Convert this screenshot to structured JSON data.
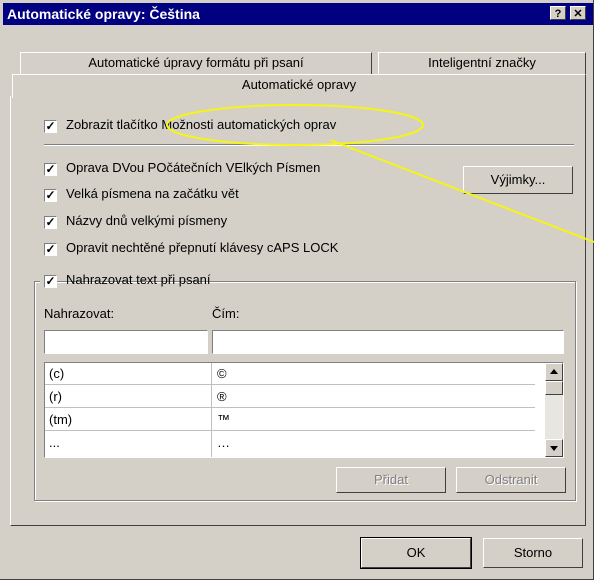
{
  "window": {
    "title": "Automatické opravy: Čeština",
    "help_label": "?",
    "close_label": "✕"
  },
  "tabs": {
    "back": [
      "Automatické úpravy formátu při psaní",
      "Inteligentní značky"
    ],
    "active": "Automatické opravy"
  },
  "options": {
    "show_buttons": {
      "label": "Zobrazit tlačítko Možnosti automatických oprav",
      "checked": true
    },
    "items": [
      {
        "label": "Oprava DVou POčátečních VElkých Písmen",
        "checked": true
      },
      {
        "label": "Velká písmena na začátku vět",
        "checked": true
      },
      {
        "label": "Názvy dnů velkými písmeny",
        "checked": true
      },
      {
        "label": "Opravit nechtěné přepnutí klávesy cAPS LOCK",
        "checked": true
      }
    ],
    "exceptions_button": "Výjimky..."
  },
  "replace": {
    "group_label": "Nahrazovat text při psaní",
    "checked": true,
    "replace_label": "Nahrazovat:",
    "with_label": "Čím:",
    "replace_value": "",
    "with_value": "",
    "rows": [
      {
        "from": "(c)",
        "to": "©"
      },
      {
        "from": "(r)",
        "to": "®"
      },
      {
        "from": "(tm)",
        "to": "™"
      },
      {
        "from": "...",
        "to": "…"
      }
    ],
    "add_button": "Přidat",
    "delete_button": "Odstranit"
  },
  "footer": {
    "ok": "OK",
    "cancel": "Storno"
  },
  "colors": {
    "titlebar": "#000080",
    "face": "#d4d0c8",
    "callout": "#f5f514"
  }
}
